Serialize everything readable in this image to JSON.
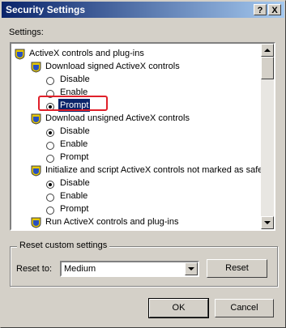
{
  "window": {
    "title": "Security Settings"
  },
  "title_buttons": {
    "help": "?",
    "close": "X"
  },
  "settings_label": "Settings:",
  "tree": [
    {
      "type": "category",
      "label": "ActiveX controls and plug-ins",
      "icon": "settings-shield-icon"
    },
    {
      "type": "category",
      "label": "Download signed ActiveX controls",
      "icon": "settings-shield-icon"
    },
    {
      "type": "option",
      "label": "Disable",
      "checked": false
    },
    {
      "type": "option",
      "label": "Enable",
      "checked": false
    },
    {
      "type": "option",
      "label": "Prompt",
      "checked": true,
      "selected": true
    },
    {
      "type": "category",
      "label": "Download unsigned ActiveX controls",
      "icon": "settings-shield-icon"
    },
    {
      "type": "option",
      "label": "Disable",
      "checked": true
    },
    {
      "type": "option",
      "label": "Enable",
      "checked": false
    },
    {
      "type": "option",
      "label": "Prompt",
      "checked": false
    },
    {
      "type": "category",
      "label": "Initialize and script ActiveX controls not marked as safe",
      "icon": "settings-shield-icon"
    },
    {
      "type": "option",
      "label": "Disable",
      "checked": true
    },
    {
      "type": "option",
      "label": "Enable",
      "checked": false
    },
    {
      "type": "option",
      "label": "Prompt",
      "checked": false
    },
    {
      "type": "category",
      "label": "Run ActiveX controls and plug-ins",
      "icon": "settings-shield-icon"
    }
  ],
  "reset_group": {
    "title": "Reset custom settings",
    "reset_to_label": "Reset to:",
    "selected_value": "Medium",
    "reset_button": "Reset"
  },
  "buttons": {
    "ok": "OK",
    "cancel": "Cancel"
  },
  "colors": {
    "highlight_box": "#e0202a",
    "selection": "#0a246a",
    "title_bar": "#0a246a"
  }
}
